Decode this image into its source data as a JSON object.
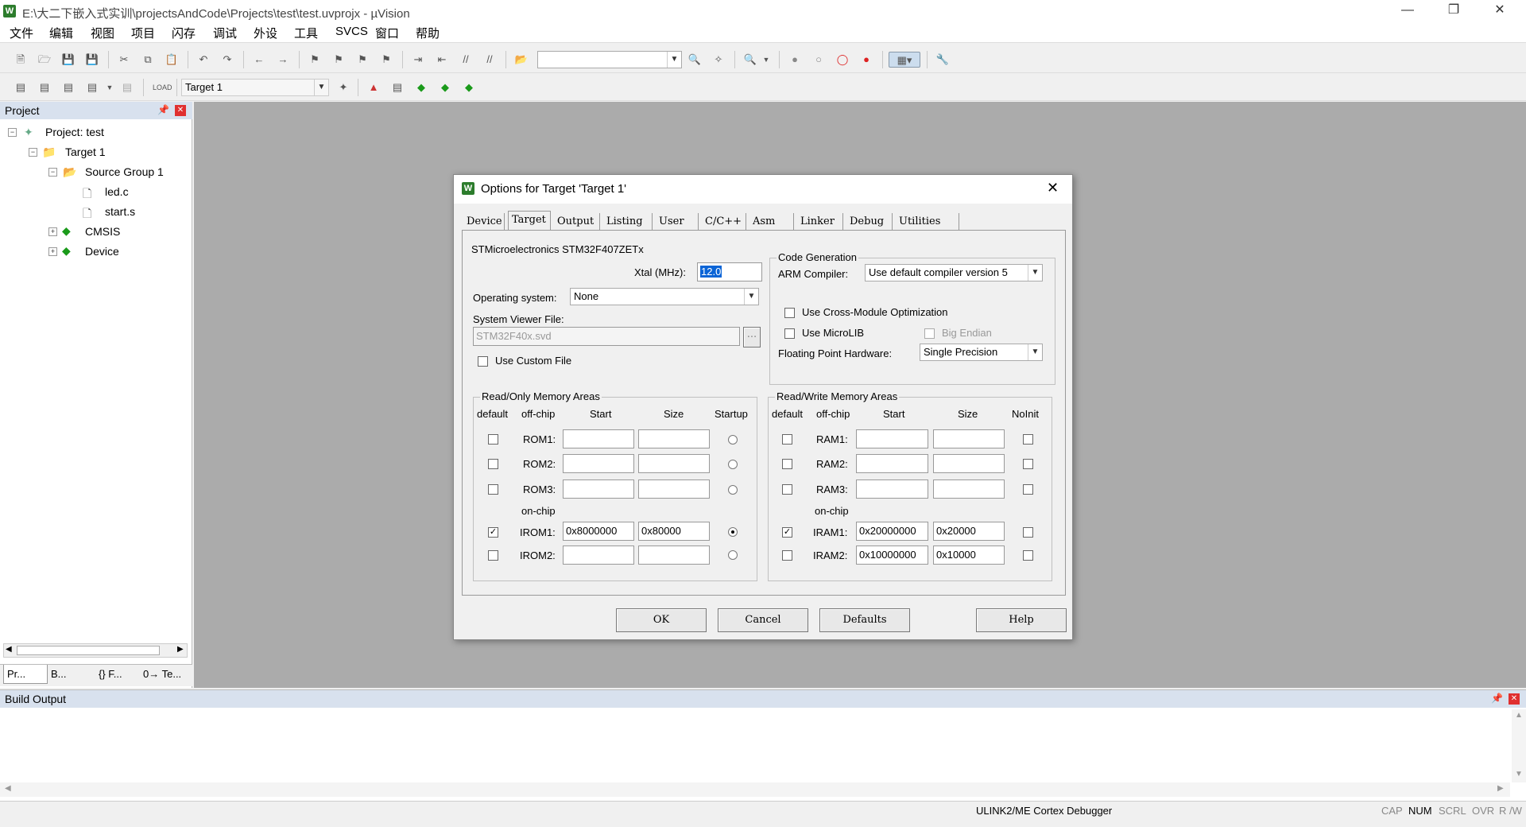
{
  "window": {
    "title": "E:\\大二下嵌入式实训\\projectsAndCode\\Projects\\test\\test.uvprojx - µVision",
    "app_icon": "W"
  },
  "menu": [
    "文件",
    "编辑",
    "视图",
    "项目",
    "闪存",
    "调试",
    "外设",
    "工具",
    "SVCS",
    "窗口",
    "帮助"
  ],
  "toolbar2": {
    "target": "Target 1"
  },
  "project": {
    "header": "Project",
    "root": "Project: test",
    "target": "Target 1",
    "group": "Source Group 1",
    "files": [
      "led.c",
      "start.s"
    ],
    "cmsis": "CMSIS",
    "device": "Device",
    "bottom_tabs": [
      "Pr...",
      "B...",
      "{} F...",
      "0→ Te..."
    ]
  },
  "dialog": {
    "title": "Options for Target 'Target 1'",
    "tabs": [
      "Device",
      "Target",
      "Output",
      "Listing",
      "User",
      "C/C++",
      "Asm",
      "Linker",
      "Debug",
      "Utilities"
    ],
    "active_tab": "Target",
    "device_name": "STMicroelectronics STM32F407ZETx",
    "xtal_label": "Xtal (MHz):",
    "xtal_value": "12.0",
    "os_label": "Operating system:",
    "os_value": "None",
    "svd_label": "System Viewer File:",
    "svd_value": "STM32F40x.svd",
    "svd_browse": "...",
    "custom_file": "Use Custom File",
    "codegen": {
      "title": "Code Generation",
      "compiler_label": "ARM Compiler:",
      "compiler_value": "Use default compiler version 5",
      "cross_module": "Use Cross-Module Optimization",
      "microlib": "Use MicroLIB",
      "big_endian": "Big Endian",
      "fph_label": "Floating Point Hardware:",
      "fph_value": "Single Precision"
    },
    "ro": {
      "title": "Read/Only Memory Areas",
      "cols": [
        "default",
        "off-chip",
        "Start",
        "Size",
        "Startup"
      ],
      "onchip": "on-chip",
      "rows": [
        {
          "name": "ROM1:",
          "start": "",
          "size": "",
          "default": false,
          "startup": false
        },
        {
          "name": "ROM2:",
          "start": "",
          "size": "",
          "default": false,
          "startup": false
        },
        {
          "name": "ROM3:",
          "start": "",
          "size": "",
          "default": false,
          "startup": false
        },
        {
          "name": "IROM1:",
          "start": "0x8000000",
          "size": "0x80000",
          "default": true,
          "startup": true
        },
        {
          "name": "IROM2:",
          "start": "",
          "size": "",
          "default": false,
          "startup": false
        }
      ]
    },
    "rw": {
      "title": "Read/Write Memory Areas",
      "cols": [
        "default",
        "off-chip",
        "Start",
        "Size",
        "NoInit"
      ],
      "onchip": "on-chip",
      "rows": [
        {
          "name": "RAM1:",
          "start": "",
          "size": "",
          "default": false,
          "noinit": false
        },
        {
          "name": "RAM2:",
          "start": "",
          "size": "",
          "default": false,
          "noinit": false
        },
        {
          "name": "RAM3:",
          "start": "",
          "size": "",
          "default": false,
          "noinit": false
        },
        {
          "name": "IRAM1:",
          "start": "0x20000000",
          "size": "0x20000",
          "default": true,
          "noinit": false
        },
        {
          "name": "IRAM2:",
          "start": "0x10000000",
          "size": "0x10000",
          "default": false,
          "noinit": false
        }
      ]
    },
    "buttons": {
      "ok": "OK",
      "cancel": "Cancel",
      "defaults": "Defaults",
      "help": "Help"
    }
  },
  "build": {
    "header": "Build Output"
  },
  "status": {
    "debugger": "ULINK2/ME Cortex Debugger",
    "indicators": [
      "CAP",
      "NUM",
      "SCRL",
      "OVR",
      "R /W"
    ]
  }
}
